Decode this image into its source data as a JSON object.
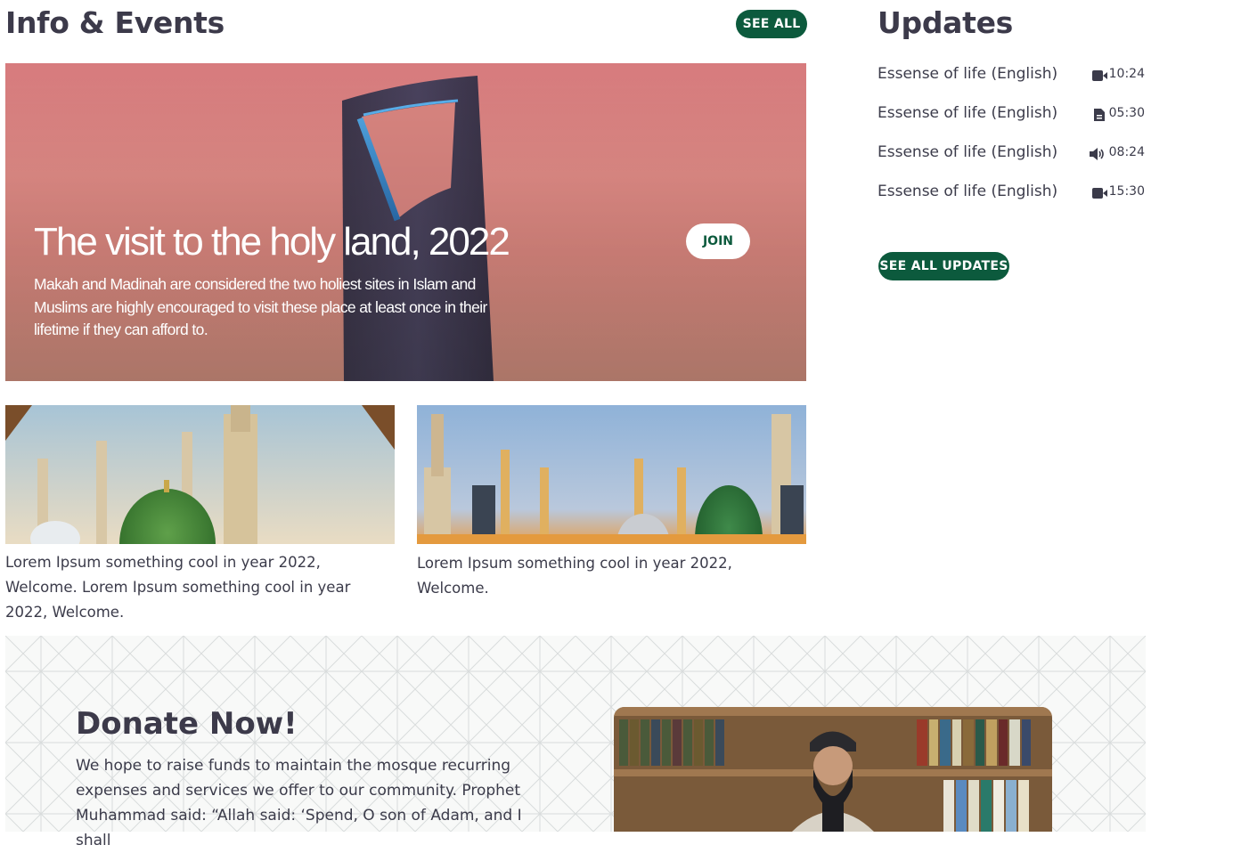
{
  "info_events": {
    "title": "Info & Events",
    "see_all_label": "SEE ALL"
  },
  "hero": {
    "title": "The visit to the holy land, 2022",
    "description": "Makah and Madinah are considered the two holiest sites in Islam and Muslims are highly encouraged to visit these place at least once in their lifetime if they can afford to.",
    "join_label": "JOIN"
  },
  "cards": [
    {
      "caption": "Lorem Ipsum something cool in year 2022, Welcome. Lorem Ipsum something cool in year 2022, Welcome."
    },
    {
      "caption": "Lorem Ipsum something cool in year 2022, Welcome."
    }
  ],
  "updates": {
    "title": "Updates",
    "items": [
      {
        "title": "Essense of life (English)",
        "icon": "video-icon",
        "time": "10:24"
      },
      {
        "title": "Essense of life (English)",
        "icon": "document-icon",
        "time": "05:30"
      },
      {
        "title": "Essense of life (English)",
        "icon": "audio-icon",
        "time": "08:24"
      },
      {
        "title": "Essense of life (English)",
        "icon": "video-icon",
        "time": "15:30"
      }
    ],
    "see_all_label": "SEE ALL UPDATES"
  },
  "donate": {
    "title": "Donate Now!",
    "text": "We hope to raise funds to maintain the mosque recurring expenses and services we offer to our community. Prophet Muhammad said: “Allah said: ‘Spend, O son of Adam, and I shall"
  },
  "colors": {
    "accent": "#0c5a3d",
    "heading": "#3c3a4a",
    "text": "#3b3b4a"
  }
}
